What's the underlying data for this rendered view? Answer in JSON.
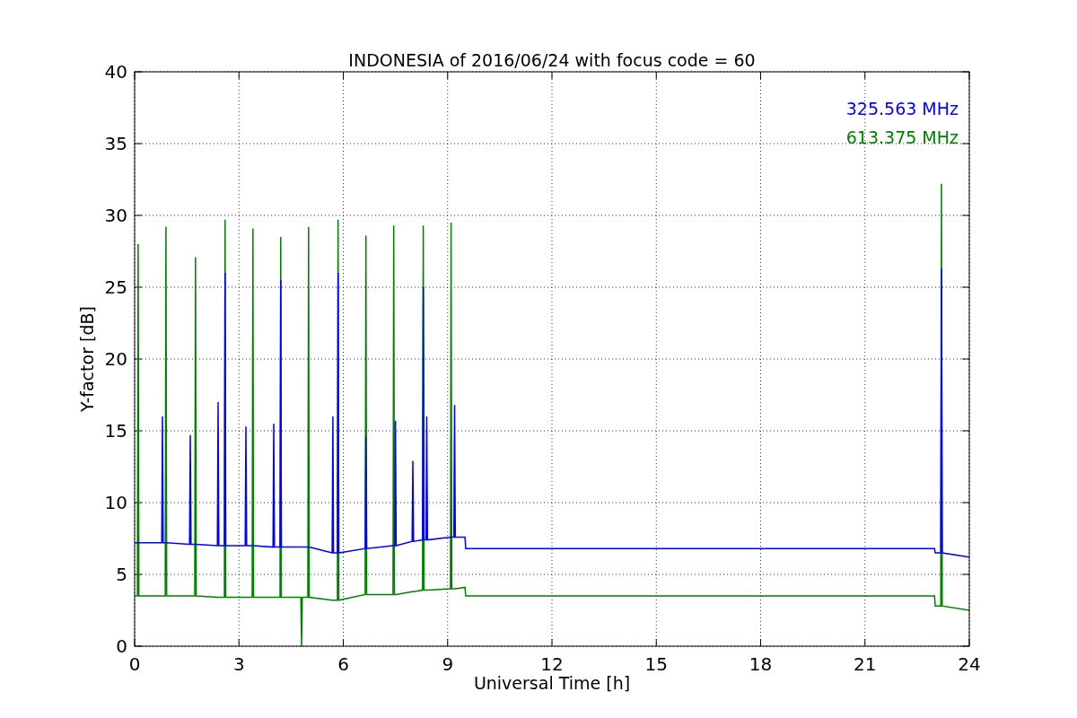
{
  "figure": {
    "chart_data": {
      "type": "line",
      "title": "INDONESIA of 2016/06/24 with focus code = 60",
      "xlabel": "Universal Time [h]",
      "ylabel": "Y-factor [dB]",
      "x": [
        0,
        0.08,
        0.1,
        0.12,
        0.78,
        0.8,
        0.82,
        0.88,
        0.9,
        0.92,
        1.58,
        1.6,
        1.62,
        1.73,
        1.75,
        1.77,
        2.38,
        2.4,
        2.42,
        2.58,
        2.6,
        2.62,
        3.18,
        3.2,
        3.22,
        3.38,
        3.4,
        3.42,
        3.98,
        4.0,
        4.02,
        4.18,
        4.2,
        4.22,
        4.78,
        4.8,
        4.82,
        4.98,
        5.0,
        5.02,
        5.68,
        5.7,
        5.72,
        5.83,
        5.85,
        5.87,
        6.63,
        6.65,
        6.67,
        7.43,
        7.45,
        7.47,
        7.48,
        7.5,
        7.52,
        7.98,
        8.0,
        8.02,
        8.28,
        8.3,
        8.32,
        8.38,
        8.4,
        8.42,
        9.08,
        9.1,
        9.12,
        9.18,
        9.2,
        9.22,
        9.5,
        9.52,
        23,
        23.02,
        23.18,
        23.2,
        23.22,
        24
      ],
      "series": [
        {
          "name": "325.563 MHz",
          "color": "#0000ff",
          "values": [
            7.2,
            7.2,
            7.2,
            7.2,
            7.2,
            16,
            7.2,
            7.2,
            7.2,
            7.2,
            7.1,
            14.7,
            7.1,
            7.1,
            7.1,
            7.1,
            7,
            17,
            7,
            7,
            26,
            7,
            7,
            15.3,
            7,
            7,
            7,
            7,
            6.9,
            15.5,
            6.9,
            6.9,
            25.5,
            6.9,
            6.9,
            6.9,
            6.9,
            6.9,
            6.9,
            6.9,
            6.5,
            16,
            6.5,
            6.5,
            26,
            6.5,
            6.8,
            14.6,
            6.8,
            7,
            7,
            7,
            7,
            15.7,
            7,
            7.3,
            12.9,
            7.3,
            7.4,
            25,
            7.4,
            7.4,
            16,
            7.4,
            7.6,
            7.6,
            7.6,
            7.6,
            16.8,
            7.6,
            7.6,
            6.8,
            6.8,
            6.5,
            6.5,
            26.3,
            6.5,
            6.2
          ]
        },
        {
          "name": "613.375 MHz",
          "color": "#008000",
          "values": [
            3.5,
            3.5,
            28,
            3.5,
            3.5,
            3.5,
            3.5,
            3.5,
            29.2,
            3.5,
            3.5,
            3.5,
            3.5,
            3.5,
            27.1,
            3.5,
            3.4,
            3.4,
            3.4,
            3.4,
            29.7,
            3.4,
            3.4,
            3.4,
            3.4,
            3.4,
            29.1,
            3.4,
            3.4,
            3.4,
            3.4,
            3.4,
            28.5,
            3.4,
            3.4,
            0,
            3.4,
            3.4,
            29.2,
            3.4,
            3.2,
            3.2,
            3.2,
            3.2,
            29.7,
            3.2,
            3.6,
            28.6,
            3.6,
            3.6,
            29.3,
            3.6,
            3.6,
            3.6,
            3.6,
            3.8,
            3.8,
            3.8,
            3.9,
            29.3,
            3.9,
            3.9,
            3.9,
            3.9,
            4,
            29.5,
            4,
            4,
            4,
            4,
            4.1,
            3.5,
            3.5,
            2.8,
            2.8,
            32.2,
            2.8,
            2.5
          ]
        }
      ],
      "xlim": [
        0,
        24
      ],
      "ylim": [
        0,
        40
      ],
      "xticks": [
        0,
        3,
        6,
        9,
        12,
        15,
        18,
        21,
        24
      ],
      "yticks": [
        0,
        5,
        10,
        15,
        20,
        25,
        30,
        35,
        40
      ],
      "grid": true
    }
  }
}
